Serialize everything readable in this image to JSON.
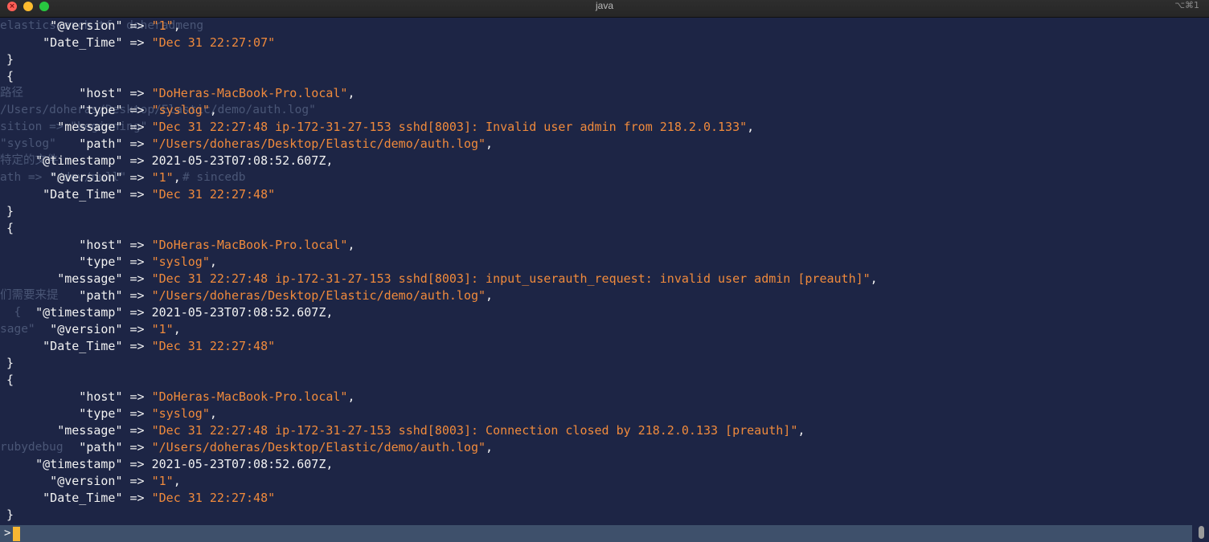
{
  "window": {
    "title": "java",
    "shortcut": "⌥⌘1"
  },
  "ghost_text": [
    "elasticsearch tf  doheradmeng",
    "",
    "",
    "",
    "路径",
    "/Users/doheras/Desktop/Elastic/demo/auth.log\"",
    "sition => \"beginning\"",
    "\"syslog\"",
    "特定的文件",
    "ath => \"/dev/null\"        # sincedb",
    "",
    "",
    "",
    "",
    "",
    "",
    "们需要来提",
    "  {",
    "sage\"",
    "",
    "",
    "",
    "",
    "",
    "",
    "rubydebug"
  ],
  "lines": [
    {
      "key": "      \"@version\" => ",
      "str": "\"1\"",
      "tail": ","
    },
    {
      "key": "     \"Date_Time\" => ",
      "str": "\"Dec 31 22:27:07\"",
      "tail": ""
    },
    {
      "key": "}",
      "str": "",
      "tail": ""
    },
    {
      "key": "{",
      "str": "",
      "tail": ""
    },
    {
      "key": "          \"host\" => ",
      "str": "\"DoHeras-MacBook-Pro.local\"",
      "tail": ","
    },
    {
      "key": "          \"type\" => ",
      "str": "\"syslog\"",
      "tail": ","
    },
    {
      "key": "       \"message\" => ",
      "str": "\"Dec 31 22:27:48 ip-172-31-27-153 sshd[8003]: Invalid user admin from 218.2.0.133\"",
      "tail": ","
    },
    {
      "key": "          \"path\" => ",
      "str": "\"/Users/doheras/Desktop/Elastic/demo/auth.log\"",
      "tail": ","
    },
    {
      "key": "    \"@timestamp\" => 2021-05-23T07:08:52.607Z,",
      "str": "",
      "tail": ""
    },
    {
      "key": "      \"@version\" => ",
      "str": "\"1\"",
      "tail": ","
    },
    {
      "key": "     \"Date_Time\" => ",
      "str": "\"Dec 31 22:27:48\"",
      "tail": ""
    },
    {
      "key": "}",
      "str": "",
      "tail": ""
    },
    {
      "key": "{",
      "str": "",
      "tail": ""
    },
    {
      "key": "          \"host\" => ",
      "str": "\"DoHeras-MacBook-Pro.local\"",
      "tail": ","
    },
    {
      "key": "          \"type\" => ",
      "str": "\"syslog\"",
      "tail": ","
    },
    {
      "key": "       \"message\" => ",
      "str": "\"Dec 31 22:27:48 ip-172-31-27-153 sshd[8003]: input_userauth_request: invalid user admin [preauth]\"",
      "tail": ","
    },
    {
      "key": "          \"path\" => ",
      "str": "\"/Users/doheras/Desktop/Elastic/demo/auth.log\"",
      "tail": ","
    },
    {
      "key": "    \"@timestamp\" => 2021-05-23T07:08:52.607Z,",
      "str": "",
      "tail": ""
    },
    {
      "key": "      \"@version\" => ",
      "str": "\"1\"",
      "tail": ","
    },
    {
      "key": "     \"Date_Time\" => ",
      "str": "\"Dec 31 22:27:48\"",
      "tail": ""
    },
    {
      "key": "}",
      "str": "",
      "tail": ""
    },
    {
      "key": "{",
      "str": "",
      "tail": ""
    },
    {
      "key": "          \"host\" => ",
      "str": "\"DoHeras-MacBook-Pro.local\"",
      "tail": ","
    },
    {
      "key": "          \"type\" => ",
      "str": "\"syslog\"",
      "tail": ","
    },
    {
      "key": "       \"message\" => ",
      "str": "\"Dec 31 22:27:48 ip-172-31-27-153 sshd[8003]: Connection closed by 218.2.0.133 [preauth]\"",
      "tail": ","
    },
    {
      "key": "          \"path\" => ",
      "str": "\"/Users/doheras/Desktop/Elastic/demo/auth.log\"",
      "tail": ","
    },
    {
      "key": "    \"@timestamp\" => 2021-05-23T07:08:52.607Z,",
      "str": "",
      "tail": ""
    },
    {
      "key": "      \"@version\" => ",
      "str": "\"1\"",
      "tail": ","
    },
    {
      "key": "     \"Date_Time\" => ",
      "str": "\"Dec 31 22:27:48\"",
      "tail": ""
    },
    {
      "key": "}",
      "str": "",
      "tail": ""
    }
  ],
  "input": {
    "prompt": ">"
  },
  "colors": {
    "background": "#1d2545",
    "string": "#f08a3c",
    "text": "#f2f2f2",
    "cursor": "#f7b733",
    "input_bar": "#3e506b"
  }
}
